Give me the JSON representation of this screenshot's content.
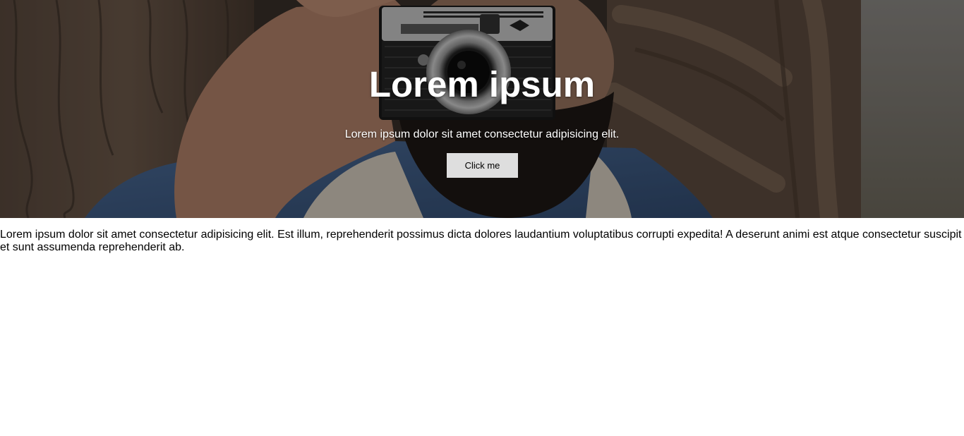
{
  "hero": {
    "title": "Lorem ipsum",
    "subtitle": "Lorem ipsum dolor sit amet consectetur adipisicing elit.",
    "button_label": "Click me",
    "camera_brand_text": "ISO-RAPID  IF",
    "background_photo": "man-with-camera-photo"
  },
  "content": {
    "paragraph": "Lorem ipsum dolor sit amet consectetur adipisicing elit. Est illum, reprehenderit possimus dicta dolores laudantium voluptatibus corrupti expedita! A deserunt animi est atque consectetur suscipit et sunt assumenda reprehenderit ab."
  },
  "colors": {
    "text": "#000000",
    "hero_text": "#ffffff",
    "button_bg": "#dedede"
  }
}
